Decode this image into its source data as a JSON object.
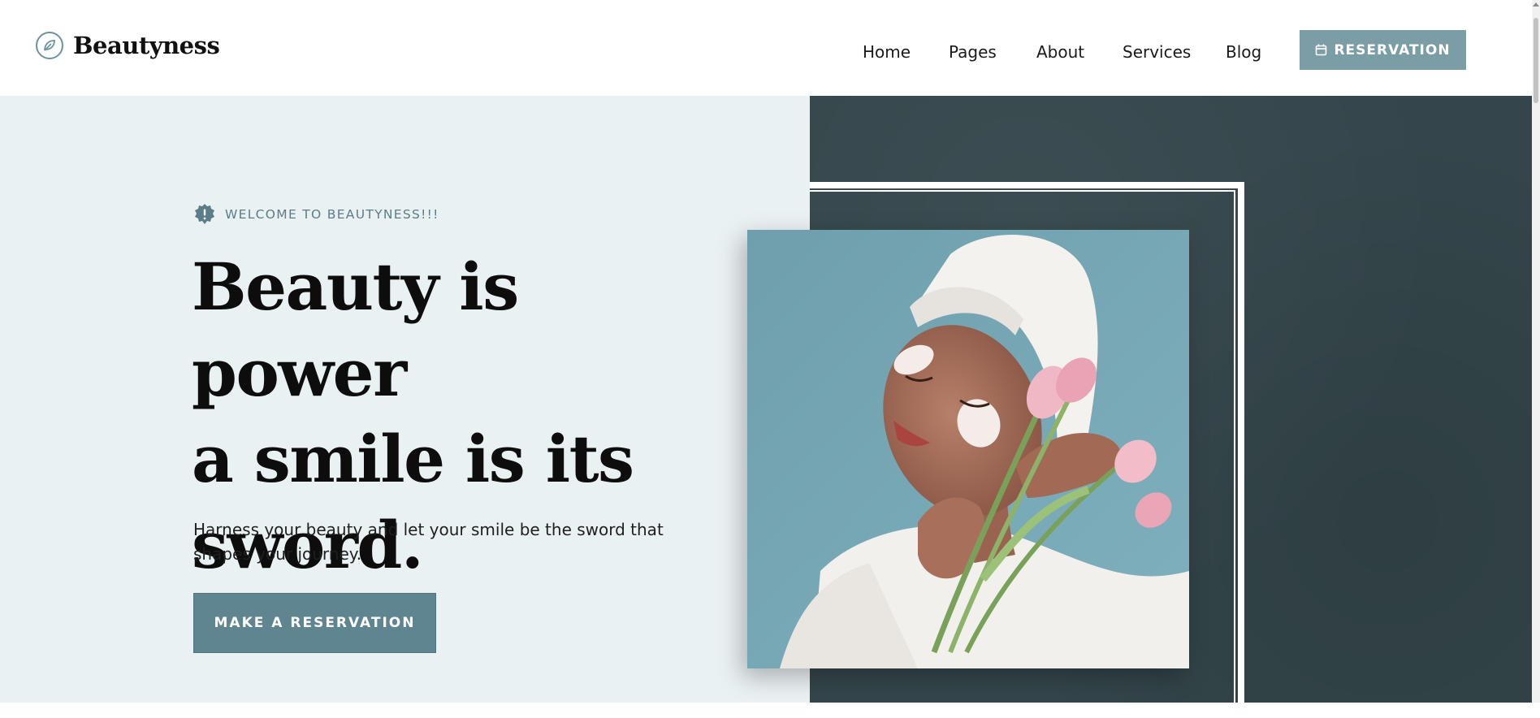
{
  "header": {
    "brand": "Beautyness",
    "nav": [
      "Home",
      "Pages",
      "About",
      "Services",
      "Blog"
    ],
    "reservation_label": "RESERVATION"
  },
  "hero": {
    "eyebrow": "WELCOME TO BEAUTYNESS!!!",
    "headline_lines": [
      "Beauty is power",
      "a smile is its",
      "sword."
    ],
    "subtext": "Harness your beauty and let your smile be the sword that shapes your journey.",
    "cta_label": "MAKE A RESERVATION"
  },
  "colors": {
    "accent": "#7a9da6",
    "cta": "#5f8590",
    "hero_left_bg": "#eaf1f3",
    "hero_right_bg": "#34464b",
    "photo_bg": "#6fa2b0"
  },
  "icons": {
    "logo": "leaf-circle-icon",
    "eyebrow": "badge-exclamation-icon",
    "reservation": "calendar-icon"
  }
}
